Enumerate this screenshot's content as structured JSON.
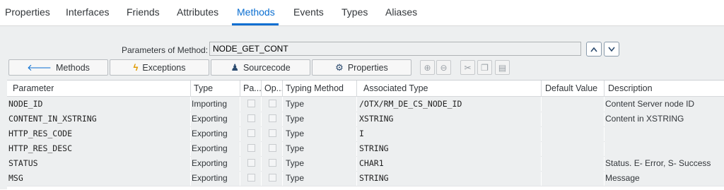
{
  "tabs": [
    "Properties",
    "Interfaces",
    "Friends",
    "Attributes",
    "Methods",
    "Events",
    "Types",
    "Aliases"
  ],
  "active_tab": "Methods",
  "parameters_label": "Parameters of Method:",
  "method_name": "NODE_GET_CONT",
  "toolbar": {
    "methods": "Methods",
    "exceptions": "Exceptions",
    "sourcecode": "Sourcecode",
    "properties": "Properties"
  },
  "columns": [
    "Parameter",
    "Type",
    "Pa...",
    "Op...",
    "Typing Method",
    "Associated Type",
    "Default Value",
    "Description"
  ],
  "rows": [
    {
      "parameter": "NODE_ID",
      "type": "Importing",
      "typing": "Type",
      "assoc": "/OTX/RM_DE_CS_NODE_ID",
      "default": "",
      "desc": "Content Server node ID"
    },
    {
      "parameter": "CONTENT_IN_XSTRING",
      "type": "Exporting",
      "typing": "Type",
      "assoc": "XSTRING",
      "default": "",
      "desc": "Content in XSTRING"
    },
    {
      "parameter": "HTTP_RES_CODE",
      "type": "Exporting",
      "typing": "Type",
      "assoc": "I",
      "default": "",
      "desc": ""
    },
    {
      "parameter": "HTTP_RES_DESC",
      "type": "Exporting",
      "typing": "Type",
      "assoc": "STRING",
      "default": "",
      "desc": ""
    },
    {
      "parameter": "STATUS",
      "type": "Exporting",
      "typing": "Type",
      "assoc": "CHAR1",
      "default": "",
      "desc": "Status. E- Error, S- Success"
    },
    {
      "parameter": "MSG",
      "type": "Exporting",
      "typing": "Type",
      "assoc": "STRING",
      "default": "",
      "desc": "Message"
    }
  ],
  "colors": {
    "accent": "#0a6ed1",
    "header_text": "#32363a",
    "row_bg": "#edeff0"
  }
}
